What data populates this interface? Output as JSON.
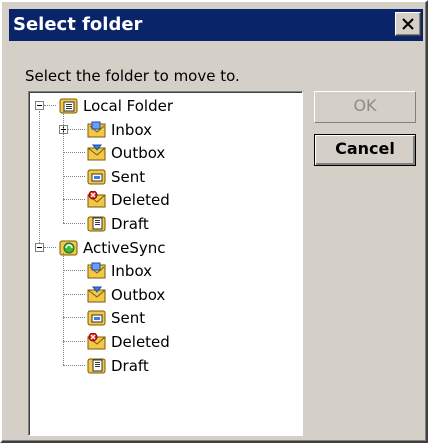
{
  "dialog": {
    "title": "Select folder",
    "prompt": "Select the folder to move to.",
    "ok_label": "OK",
    "cancel_label": "Cancel",
    "close_icon": "close-icon"
  },
  "tree": {
    "roots": [
      {
        "label": "Local Folder",
        "expanded": true,
        "icon": "local-folder-icon",
        "children": [
          {
            "label": "Inbox",
            "icon": "inbox-icon",
            "has_children": true,
            "expanded": false
          },
          {
            "label": "Outbox",
            "icon": "outbox-icon"
          },
          {
            "label": "Sent",
            "icon": "sent-icon"
          },
          {
            "label": "Deleted",
            "icon": "deleted-icon"
          },
          {
            "label": "Draft",
            "icon": "draft-icon"
          }
        ]
      },
      {
        "label": "ActiveSync",
        "expanded": true,
        "icon": "activesync-icon",
        "children": [
          {
            "label": "Inbox",
            "icon": "inbox-icon"
          },
          {
            "label": "Outbox",
            "icon": "outbox-icon"
          },
          {
            "label": "Sent",
            "icon": "sent-icon"
          },
          {
            "label": "Deleted",
            "icon": "deleted-icon"
          },
          {
            "label": "Draft",
            "icon": "draft-icon"
          }
        ]
      }
    ]
  },
  "colors": {
    "titlebar": "#0a246a",
    "face": "#d4d0c8",
    "disabled_text": "#8c8c8c"
  }
}
